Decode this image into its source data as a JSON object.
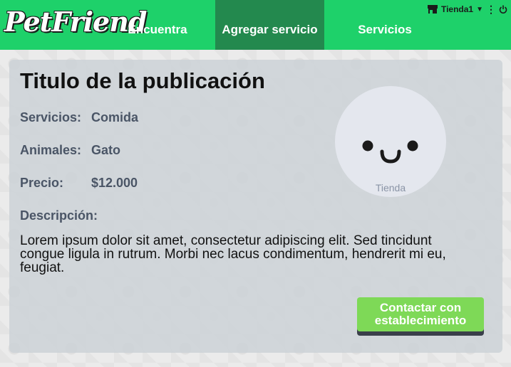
{
  "app": {
    "logo_text": "PetFriend"
  },
  "nav": {
    "items": [
      {
        "label": "Encuentra"
      },
      {
        "label": "Agregar servicio"
      },
      {
        "label": "Servicios"
      }
    ],
    "active_index": 1,
    "user": {
      "name": "Tienda1",
      "icons": [
        "store-icon",
        "caret-down-icon",
        "more-vertical-icon",
        "power-icon"
      ]
    }
  },
  "publication": {
    "title": "Titulo de la publicación",
    "fields": [
      {
        "label": "Servicios:",
        "value": "Comida"
      },
      {
        "label": "Animales:",
        "value": "Gato"
      },
      {
        "label": "Precio:",
        "value": "$12.000"
      }
    ],
    "description_label": "Descripción:",
    "description": "Lorem ipsum dolor sit amet, consectetur adipiscing elit. Sed tincidunt congue ligula in rutrum. Morbi nec lacus condimentum, hendrerit mi eu, feugiat.",
    "store_caption": "Tienda",
    "contact_button": "Contactar con establecimiento"
  },
  "colors": {
    "navbar": "#1ed16a",
    "nav_active": "#23894e",
    "button": "#7ed957",
    "label": "#4a5566"
  }
}
